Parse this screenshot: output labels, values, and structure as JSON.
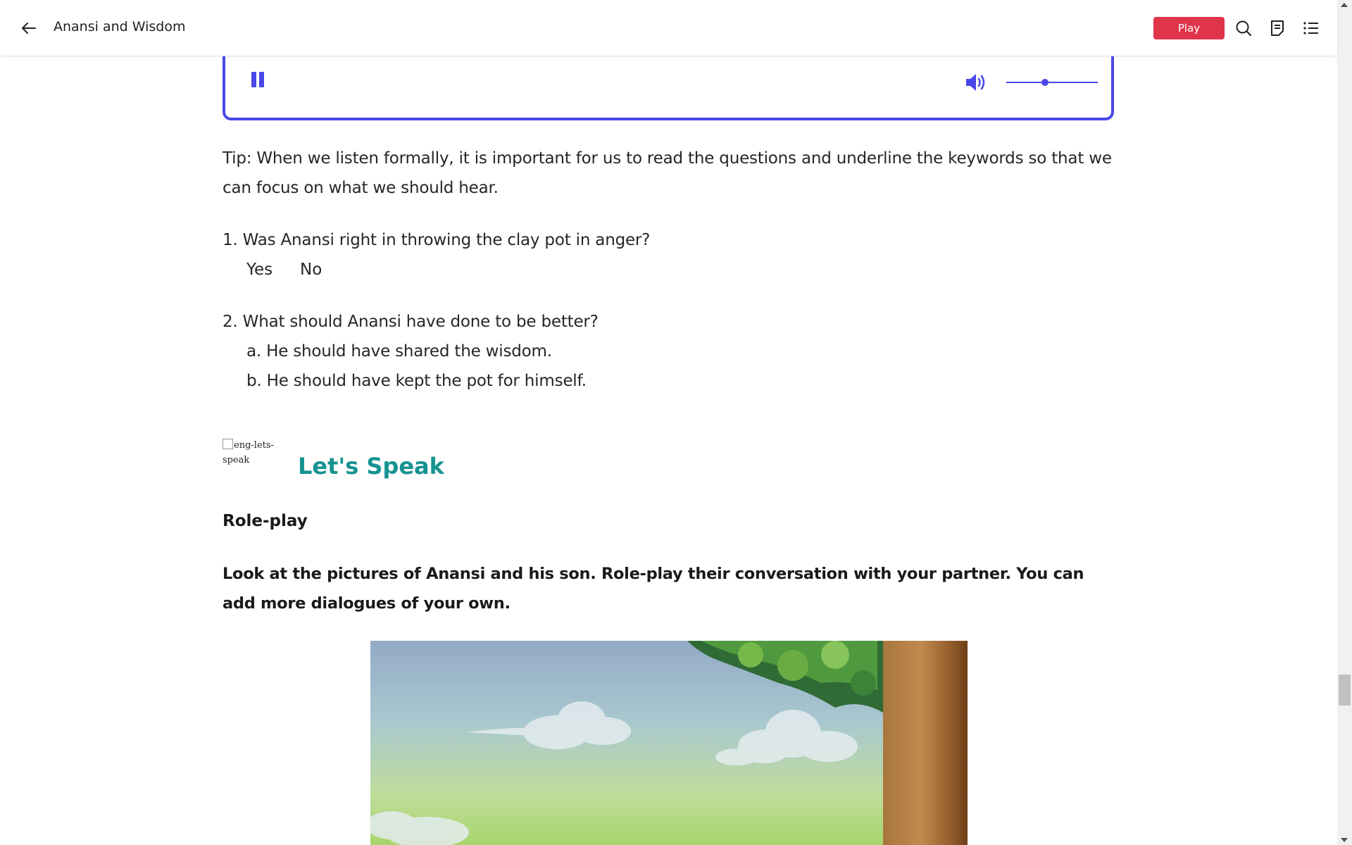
{
  "header": {
    "title": "Anansi and Wisdom",
    "play_label": "Play",
    "icons": [
      "back-arrow-icon",
      "search-icon",
      "notes-icon",
      "list-icon"
    ]
  },
  "audio_player": {
    "state": "playing",
    "volume_level": 0.42,
    "accent_color": "#4a47e8"
  },
  "content": {
    "tip": "Tip: When we listen formally, it is important for us to read the questions and underline the keywords so that we can focus on what we should hear.",
    "question1": {
      "text": "1. Was Anansi right in throwing the clay pot in anger?",
      "options": [
        "Yes",
        "No"
      ]
    },
    "question2": {
      "text": "2. What should Anansi have done to be better?",
      "options": [
        "a. He should have shared the wisdom.",
        "b. He should have kept the pot for himself."
      ]
    },
    "lets_speak_alt": "eng-lets-speak",
    "lets_speak_heading": "Let's Speak",
    "roleplay_heading": "Role-play",
    "instruction": "Look at the pictures of Anansi and his son. Role-play their conversation with your partner. You can add more dialogues of your own."
  },
  "colors": {
    "play_button": "#e0344b",
    "heading_teal": "#169391"
  }
}
